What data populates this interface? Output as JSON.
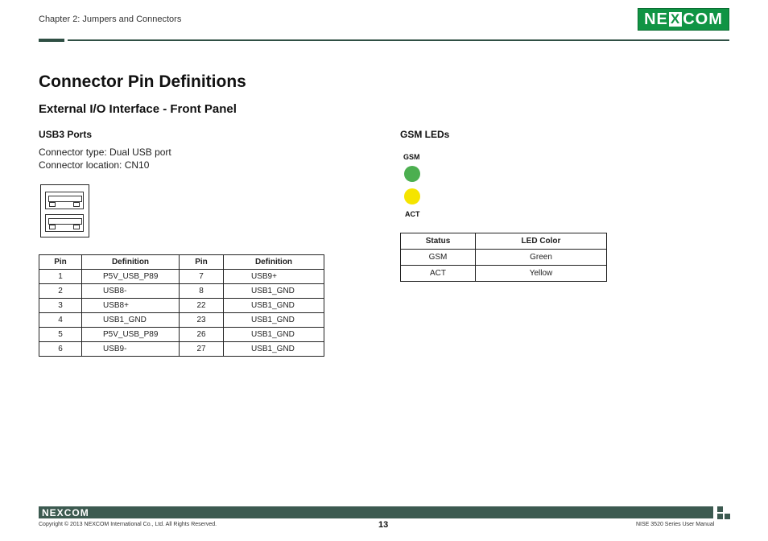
{
  "header": {
    "chapter": "Chapter 2: Jumpers and Connectors",
    "logo_parts": [
      "NE",
      "X",
      "COM"
    ]
  },
  "page": {
    "title": "Connector Pin Definitions",
    "subtitle": "External I/O Interface - Front Panel"
  },
  "usb": {
    "heading": "USB3 Ports",
    "connector_type": "Connector type: Dual USB port",
    "connector_location": "Connector location: CN10",
    "table_headers": [
      "Pin",
      "Definition",
      "Pin",
      "Definition"
    ],
    "rows": [
      [
        "1",
        "P5V_USB_P89",
        "7",
        "USB9+"
      ],
      [
        "2",
        "USB8-",
        "8",
        "USB1_GND"
      ],
      [
        "3",
        "USB8+",
        "22",
        "USB1_GND"
      ],
      [
        "4",
        "USB1_GND",
        "23",
        "USB1_GND"
      ],
      [
        "5",
        "P5V_USB_P89",
        "26",
        "USB1_GND"
      ],
      [
        "6",
        "USB9-",
        "27",
        "USB1_GND"
      ]
    ]
  },
  "gsm": {
    "heading": "GSM LEDs",
    "led_top_label": "GSM",
    "led_bottom_label": "ACT",
    "led_colors": {
      "gsm": "#4caf50",
      "act": "#f5e400"
    },
    "table_headers": [
      "Status",
      "LED Color"
    ],
    "rows": [
      [
        "GSM",
        "Green"
      ],
      [
        "ACT",
        "Yellow"
      ]
    ]
  },
  "footer": {
    "logo_parts": [
      "NE",
      "X",
      "COM"
    ],
    "copyright": "Copyright © 2013 NEXCOM International Co., Ltd. All Rights Reserved.",
    "page_number": "13",
    "manual_title": "NISE 3520 Series User Manual"
  },
  "colors": {
    "brand_green": "#109444",
    "dark_bar": "#3c5a50"
  }
}
